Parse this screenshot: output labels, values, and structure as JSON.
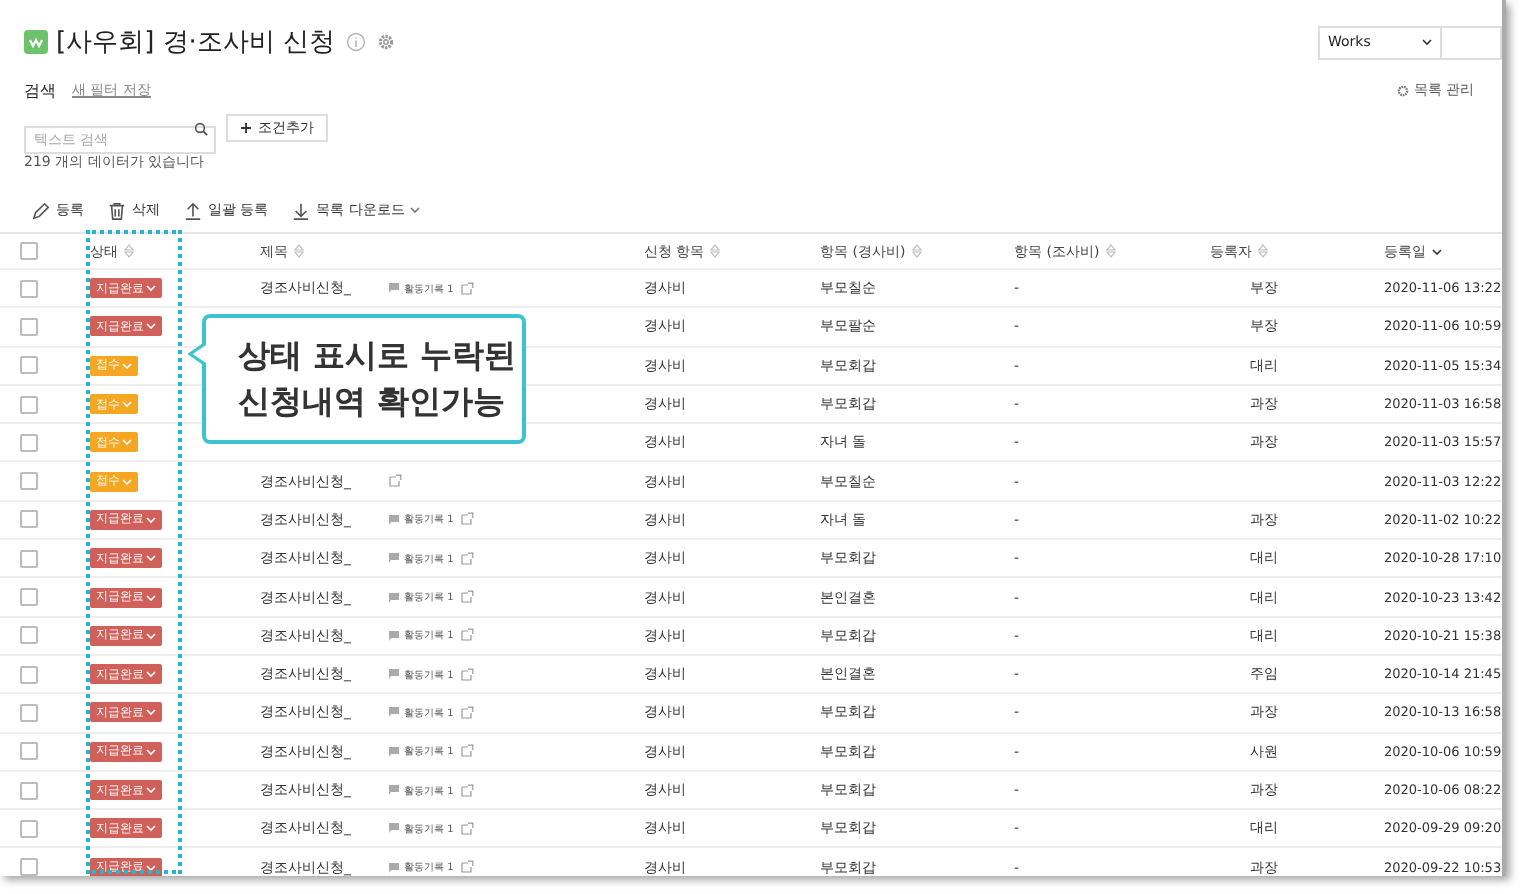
{
  "header": {
    "app_title": "[사우회] 경·조사비 신청",
    "view_select": "Works",
    "manage_link": "목록 관리"
  },
  "search": {
    "label": "검색",
    "save_filter": "새 필터 저장",
    "placeholder": "텍스트 검색",
    "add_condition": "조건추가",
    "result_count": "219 개의 데이터가 있습니다"
  },
  "toolbar": [
    {
      "kind": "register",
      "label": "등록"
    },
    {
      "kind": "delete",
      "label": "삭제"
    },
    {
      "kind": "upload",
      "label": "일괄 등록"
    },
    {
      "kind": "download",
      "label": "목록 다운로드"
    }
  ],
  "table": {
    "select_all": {
      "checked": false
    },
    "columns": [
      {
        "label": "상태",
        "sorted": false
      },
      {
        "label": "제목",
        "sorted": false
      },
      {
        "label": "신청 항목",
        "sorted": false
      },
      {
        "label": "항목 (경사비)",
        "sorted": false
      },
      {
        "label": "항목 (조사비)",
        "sorted": false
      },
      {
        "label": "등록자",
        "sorted": false
      },
      {
        "label": "등록일",
        "sorted": true
      }
    ],
    "rows": [
      {
        "checked": false,
        "status": "지급완료",
        "color": "#d0605a",
        "title": "경조사비신청_",
        "activity": "활동기록 1",
        "category": "경사비",
        "item_gyeong": "부모칠순",
        "item_jo": "-",
        "registrant": "부장",
        "date": "2020-11-06 13:22"
      },
      {
        "checked": false,
        "status": "지급완료",
        "color": "#d0605a",
        "category": "경사비",
        "item_gyeong": "부모팔순",
        "item_jo": "-",
        "registrant": "부장",
        "date": "2020-11-06 10:59"
      },
      {
        "checked": false,
        "status": "접수",
        "color": "#f5a623",
        "category": "경사비",
        "item_gyeong": "부모회갑",
        "item_jo": "-",
        "registrant": "대리",
        "date": "2020-11-05 15:34"
      },
      {
        "checked": false,
        "status": "접수",
        "color": "#f5a623",
        "category": "경사비",
        "item_gyeong": "부모회갑",
        "item_jo": "-",
        "registrant": "과장",
        "date": "2020-11-03 16:58"
      },
      {
        "checked": false,
        "status": "접수",
        "color": "#f5a623",
        "category": "경사비",
        "item_gyeong": "자녀 돌",
        "item_jo": "-",
        "registrant": "과장",
        "date": "2020-11-03 15:57"
      },
      {
        "checked": false,
        "status": "접수",
        "color": "#f5a623",
        "title": "경조사비신청_",
        "category": "경사비",
        "item_gyeong": "부모칠순",
        "item_jo": "-",
        "date": "2020-11-03 12:22"
      },
      {
        "checked": false,
        "status": "지급완료",
        "color": "#d0605a",
        "title": "경조사비신청_",
        "activity": "활동기록 1",
        "category": "경사비",
        "item_gyeong": "자녀 돌",
        "item_jo": "-",
        "registrant": "과장",
        "date": "2020-11-02 10:22"
      },
      {
        "checked": false,
        "status": "지급완료",
        "color": "#d0605a",
        "title": "경조사비신청_",
        "activity": "활동기록 1",
        "category": "경사비",
        "item_gyeong": "부모회갑",
        "item_jo": "-",
        "registrant": "대리",
        "date": "2020-10-28 17:10"
      },
      {
        "checked": false,
        "status": "지급완료",
        "color": "#d0605a",
        "title": "경조사비신청_",
        "activity": "활동기록 1",
        "category": "경사비",
        "item_gyeong": "본인결혼",
        "item_jo": "-",
        "registrant": "대리",
        "date": "2020-10-23 13:42"
      },
      {
        "checked": false,
        "status": "지급완료",
        "color": "#d0605a",
        "title": "경조사비신청_",
        "activity": "활동기록 1",
        "category": "경사비",
        "item_gyeong": "부모회갑",
        "item_jo": "-",
        "registrant": "대리",
        "date": "2020-10-21 15:38"
      },
      {
        "checked": false,
        "status": "지급완료",
        "color": "#d0605a",
        "title": "경조사비신청_",
        "activity": "활동기록 1",
        "category": "경사비",
        "item_gyeong": "본인결혼",
        "item_jo": "-",
        "registrant": "주임",
        "date": "2020-10-14 21:45"
      },
      {
        "checked": false,
        "status": "지급완료",
        "color": "#d0605a",
        "title": "경조사비신청_",
        "activity": "활동기록 1",
        "category": "경사비",
        "item_gyeong": "부모회갑",
        "item_jo": "-",
        "registrant": "과장",
        "date": "2020-10-13 16:58"
      },
      {
        "checked": false,
        "status": "지급완료",
        "color": "#d0605a",
        "title": "경조사비신청_",
        "activity": "활동기록 1",
        "category": "경사비",
        "item_gyeong": "부모회갑",
        "item_jo": "-",
        "registrant": "사원",
        "date": "2020-10-06 10:59"
      },
      {
        "checked": false,
        "status": "지급완료",
        "color": "#d0605a",
        "title": "경조사비신청_",
        "activity": "활동기록 1",
        "category": "경사비",
        "item_gyeong": "부모회갑",
        "item_jo": "-",
        "registrant": "과장",
        "date": "2020-10-06 08:22"
      },
      {
        "checked": false,
        "status": "지급완료",
        "color": "#d0605a",
        "title": "경조사비신청_",
        "activity": "활동기록 1",
        "category": "경사비",
        "item_gyeong": "부모회갑",
        "item_jo": "-",
        "registrant": "대리",
        "date": "2020-09-29 09:20"
      },
      {
        "checked": false,
        "status": "지급완료",
        "color": "#d0605a",
        "title": "경조사비신청_",
        "activity": "활동기록 1",
        "category": "경사비",
        "item_gyeong": "부모회갑",
        "item_jo": "-",
        "registrant": "과장",
        "date": "2020-09-22 10:53"
      }
    ]
  },
  "callout": {
    "lines": [
      "상태 표시로 누락된",
      "신청내역 확인가능"
    ]
  }
}
